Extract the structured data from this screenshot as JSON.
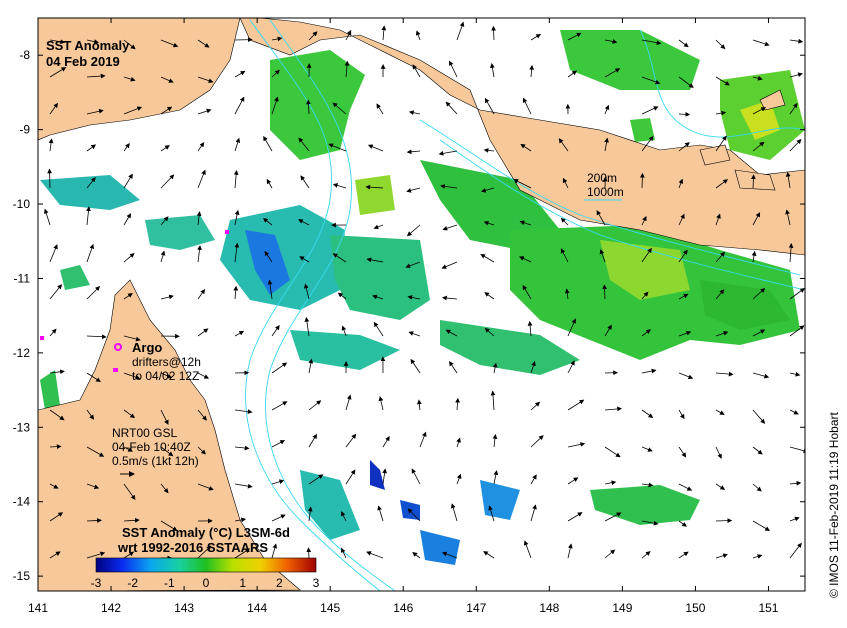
{
  "map": {
    "title": "SST Anomaly",
    "date": "04 Feb 2019",
    "lon_ticks": [
      "141",
      "142",
      "143",
      "144",
      "145",
      "146",
      "147",
      "148",
      "149",
      "150",
      "151"
    ],
    "lat_ticks": [
      "-8",
      "-9",
      "-10",
      "-11",
      "-12",
      "-13",
      "-14",
      "-15"
    ],
    "lon_range": [
      141,
      151.5
    ],
    "lat_range": [
      -15.2,
      -7.5
    ],
    "land_color": "#f6c89a",
    "isobath_color": "#38d8f0",
    "isobath_legend": [
      "200m",
      "1000m"
    ],
    "argo": {
      "label": "Argo",
      "line1": "drifters@12h",
      "line2": "to 04/02 12Z",
      "marker_color": "#ff00ff"
    },
    "current_info": {
      "line1": "NRT00 GSL",
      "line2": "04-Feb 10:40Z",
      "line3": "0.5m/s (1kt 12h)"
    },
    "colorbar": {
      "title": "SST Anomaly (°C) L3SM-6d",
      "subtitle": "wrt 1992-2016 SSTAARS",
      "ticks": [
        "-3",
        "-2",
        "-1",
        "0",
        "1",
        "2",
        "3"
      ],
      "range": [
        -3,
        3
      ]
    },
    "credit": "© IMOS 11-Feb-2019 11:19 Hobart"
  }
}
